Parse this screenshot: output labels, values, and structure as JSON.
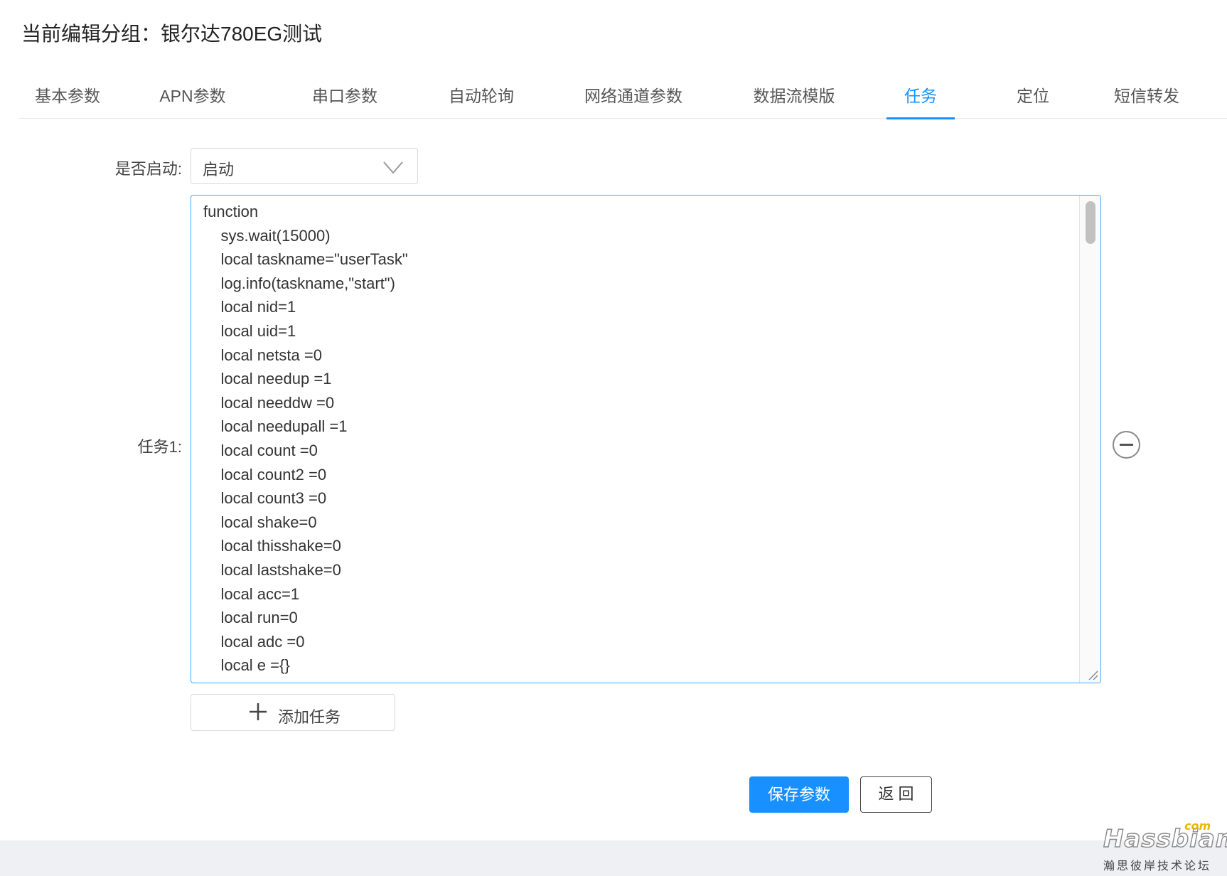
{
  "page": {
    "title": "当前编辑分组：银尔达780EG测试"
  },
  "tabs": [
    {
      "label": "基本参数",
      "active": false
    },
    {
      "label": "APN参数",
      "active": false
    },
    {
      "label": "串口参数",
      "active": false
    },
    {
      "label": "自动轮询",
      "active": false
    },
    {
      "label": "网络通道参数",
      "active": false
    },
    {
      "label": "数据流模版",
      "active": false
    },
    {
      "label": "任务",
      "active": true
    },
    {
      "label": "定位",
      "active": false
    },
    {
      "label": "短信转发",
      "active": false
    }
  ],
  "form": {
    "enable_label": "是否启动:",
    "enable_value": "启动",
    "task_label": "任务1:",
    "task_code": "function\n    sys.wait(15000)\n    local taskname=\"userTask\"\n    log.info(taskname,\"start\")\n    local nid=1\n    local uid=1\n    local netsta =0\n    local needup =1\n    local needdw =0\n    local needupall =1\n    local count =0\n    local count2 =0\n    local count3 =0\n    local shake=0\n    local thisshake=0\n    local lastshake=0\n    local acc=1\n    local run=0\n    local adc =0\n    local e ={}",
    "add_task_label": "添加任务"
  },
  "actions": {
    "save_label": "保存参数",
    "back_label": "返 回"
  },
  "watermark": {
    "logo": "Hassbian",
    "domain": "com",
    "subtitle": "瀚思彼岸技术论坛"
  },
  "colors": {
    "accent": "#1890ff",
    "footer_bg": "#eef0f3"
  }
}
